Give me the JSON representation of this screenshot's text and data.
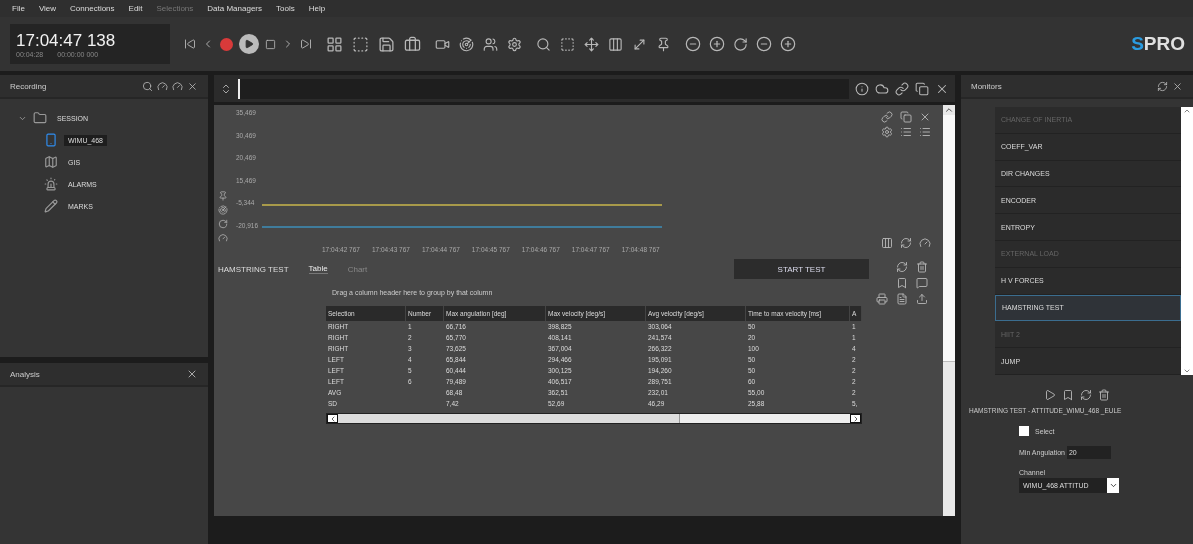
{
  "menu": [
    {
      "label": "File",
      "disabled": false
    },
    {
      "label": "View",
      "disabled": false
    },
    {
      "label": "Connections",
      "disabled": false
    },
    {
      "label": "Edit",
      "disabled": false
    },
    {
      "label": "Selections",
      "disabled": true
    },
    {
      "label": "Data Managers",
      "disabled": false
    },
    {
      "label": "Tools",
      "disabled": false
    },
    {
      "label": "Help",
      "disabled": false
    }
  ],
  "clock": {
    "time": "17:04:47 138",
    "elapsed": "00:04:28",
    "offset": "00:00:00 000"
  },
  "logo": {
    "accent": "S",
    "rest": "PRO"
  },
  "recording_panel": {
    "title": "Recording",
    "tree": [
      {
        "label": "SESSION",
        "kind": "session",
        "expanded": true,
        "selected": false,
        "children": [
          {
            "label": "WIMU_468",
            "kind": "device",
            "selected": true
          },
          {
            "label": "GIS",
            "kind": "map",
            "selected": false
          },
          {
            "label": "ALARMS",
            "kind": "alarm",
            "selected": false
          },
          {
            "label": "MARKS",
            "kind": "mark",
            "selected": false
          }
        ]
      }
    ]
  },
  "analysis_panel": {
    "title": "Analysis"
  },
  "chart": {
    "y_labels": [
      "35,469",
      "30,469",
      "20,469",
      "15,469",
      "-5,344",
      "-20,916"
    ],
    "x_labels": [
      "17:04:42 767",
      "17:04:43 767",
      "17:04:44 767",
      "17:04:45 767",
      "17:04:46 767",
      "17:04:47 767",
      "17:04:48 767"
    ],
    "traces": [
      {
        "color": "#a89a4a"
      },
      {
        "color": "#3f7c9c"
      }
    ]
  },
  "test": {
    "title": "HAMSTRING TEST",
    "tabs": [
      {
        "label": "Table",
        "selected": true
      },
      {
        "label": "Chart",
        "selected": false
      }
    ],
    "start_button": "START TEST",
    "group_hint": "Drag a column header here to group by that column",
    "table": {
      "columns": [
        "Selection",
        "Number",
        "Max angulation [deg]",
        "Max velocity [deg/s]",
        "Avg velocity [deg/s]",
        "Time to max velocity [ms]",
        "A"
      ],
      "rows": [
        [
          "RIGHT",
          "1",
          "66,716",
          "398,825",
          "303,064",
          "50",
          "1"
        ],
        [
          "RIGHT",
          "2",
          "65,770",
          "408,141",
          "241,574",
          "20",
          "1"
        ],
        [
          "RIGHT",
          "3",
          "73,625",
          "367,004",
          "266,322",
          "100",
          "4"
        ],
        [
          "LEFT",
          "4",
          "65,844",
          "294,466",
          "195,091",
          "50",
          "2"
        ],
        [
          "LEFT",
          "5",
          "60,444",
          "300,125",
          "194,260",
          "50",
          "2"
        ],
        [
          "LEFT",
          "6",
          "79,489",
          "406,517",
          "289,751",
          "60",
          "2"
        ],
        [
          "AVG",
          "",
          "68,48",
          "362,51",
          "232,01",
          "55,00",
          "2"
        ],
        [
          "SD",
          "",
          "7,42",
          "52,69",
          "46,29",
          "25,88",
          "5,"
        ]
      ]
    }
  },
  "monitors_panel": {
    "title": "Monitors",
    "items": [
      {
        "label": "CHANGE OF INERTIA",
        "selected": false,
        "disabled": true
      },
      {
        "label": "COEFF_VAR",
        "selected": false,
        "disabled": false
      },
      {
        "label": "DIR CHANGES",
        "selected": false,
        "disabled": false
      },
      {
        "label": "ENCODER",
        "selected": false,
        "disabled": false
      },
      {
        "label": "ENTROPY",
        "selected": false,
        "disabled": false
      },
      {
        "label": "EXTERNAL LOAD",
        "selected": false,
        "disabled": true
      },
      {
        "label": "H V FORCES",
        "selected": false,
        "disabled": false
      },
      {
        "label": "HAMSTRING TEST",
        "selected": true,
        "disabled": false
      },
      {
        "label": "HIIT 2",
        "selected": false,
        "disabled": true
      },
      {
        "label": "JUMP",
        "selected": false,
        "disabled": false
      }
    ],
    "caption": "HAMSTRING TEST - ATTITUDE_WIMU_468 _EULE",
    "select": {
      "label": "Select",
      "checked": false
    },
    "min_angulation": {
      "label": "Min Angulation",
      "value": "20"
    },
    "channel": {
      "label": "Channel",
      "value": "WIMU_468 ATTITUD"
    }
  }
}
